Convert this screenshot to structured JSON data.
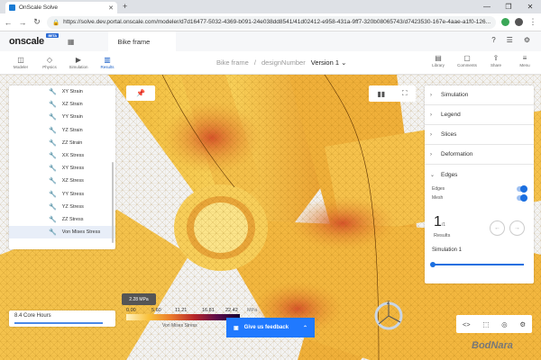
{
  "browser": {
    "tab_title": "OnScale Solve",
    "url": "https://solve.dev.portal.onscale.com/modeler/d7d16477-5032-4369-b091-24e038dd8541/41d02412-e958-431a-9ff7-320b08065743/d7423530-167e-4aae-a1f0-126..."
  },
  "app": {
    "logo": "onscale",
    "beta": "BETA",
    "doc_tab": "Bike frame"
  },
  "toolbar": {
    "modeler": "Modeler",
    "physics": "Physics",
    "simulation": "Simulation",
    "results": "Results",
    "library": "Library",
    "comments": "Comments",
    "share": "Share",
    "menu": "Menu"
  },
  "breadcrumb": {
    "project": "Bike frame",
    "sep": "/",
    "design": "designNumber",
    "version": "Version 1"
  },
  "result_list": [
    "XY Strain",
    "XZ Strain",
    "YY Strain",
    "YZ Strain",
    "ZZ Strain",
    "XX Stress",
    "XY Stress",
    "XZ Stress",
    "YY Stress",
    "YZ Stress",
    "ZZ Stress",
    "Von Mises Stress"
  ],
  "right_panel": {
    "sections": [
      "Simulation",
      "Legend",
      "Slices",
      "Deformation",
      "Edges"
    ],
    "edges_label": "Edges",
    "mesh_label": "Mesh",
    "result_number": "1",
    "result_total": "/1",
    "results_label": "Results",
    "simulation_name": "Simulation 1"
  },
  "bottom": {
    "core_hours": "8.4 Core Hours",
    "tooltip": "2.28 MPa",
    "ticks": [
      "0.00",
      "5.60",
      "11.21",
      "16.81",
      "22.42"
    ],
    "unit": "MPa",
    "legend_name": "Von Mises Stress",
    "feedback": "Give us feedback",
    "watermark": "BodNara"
  }
}
